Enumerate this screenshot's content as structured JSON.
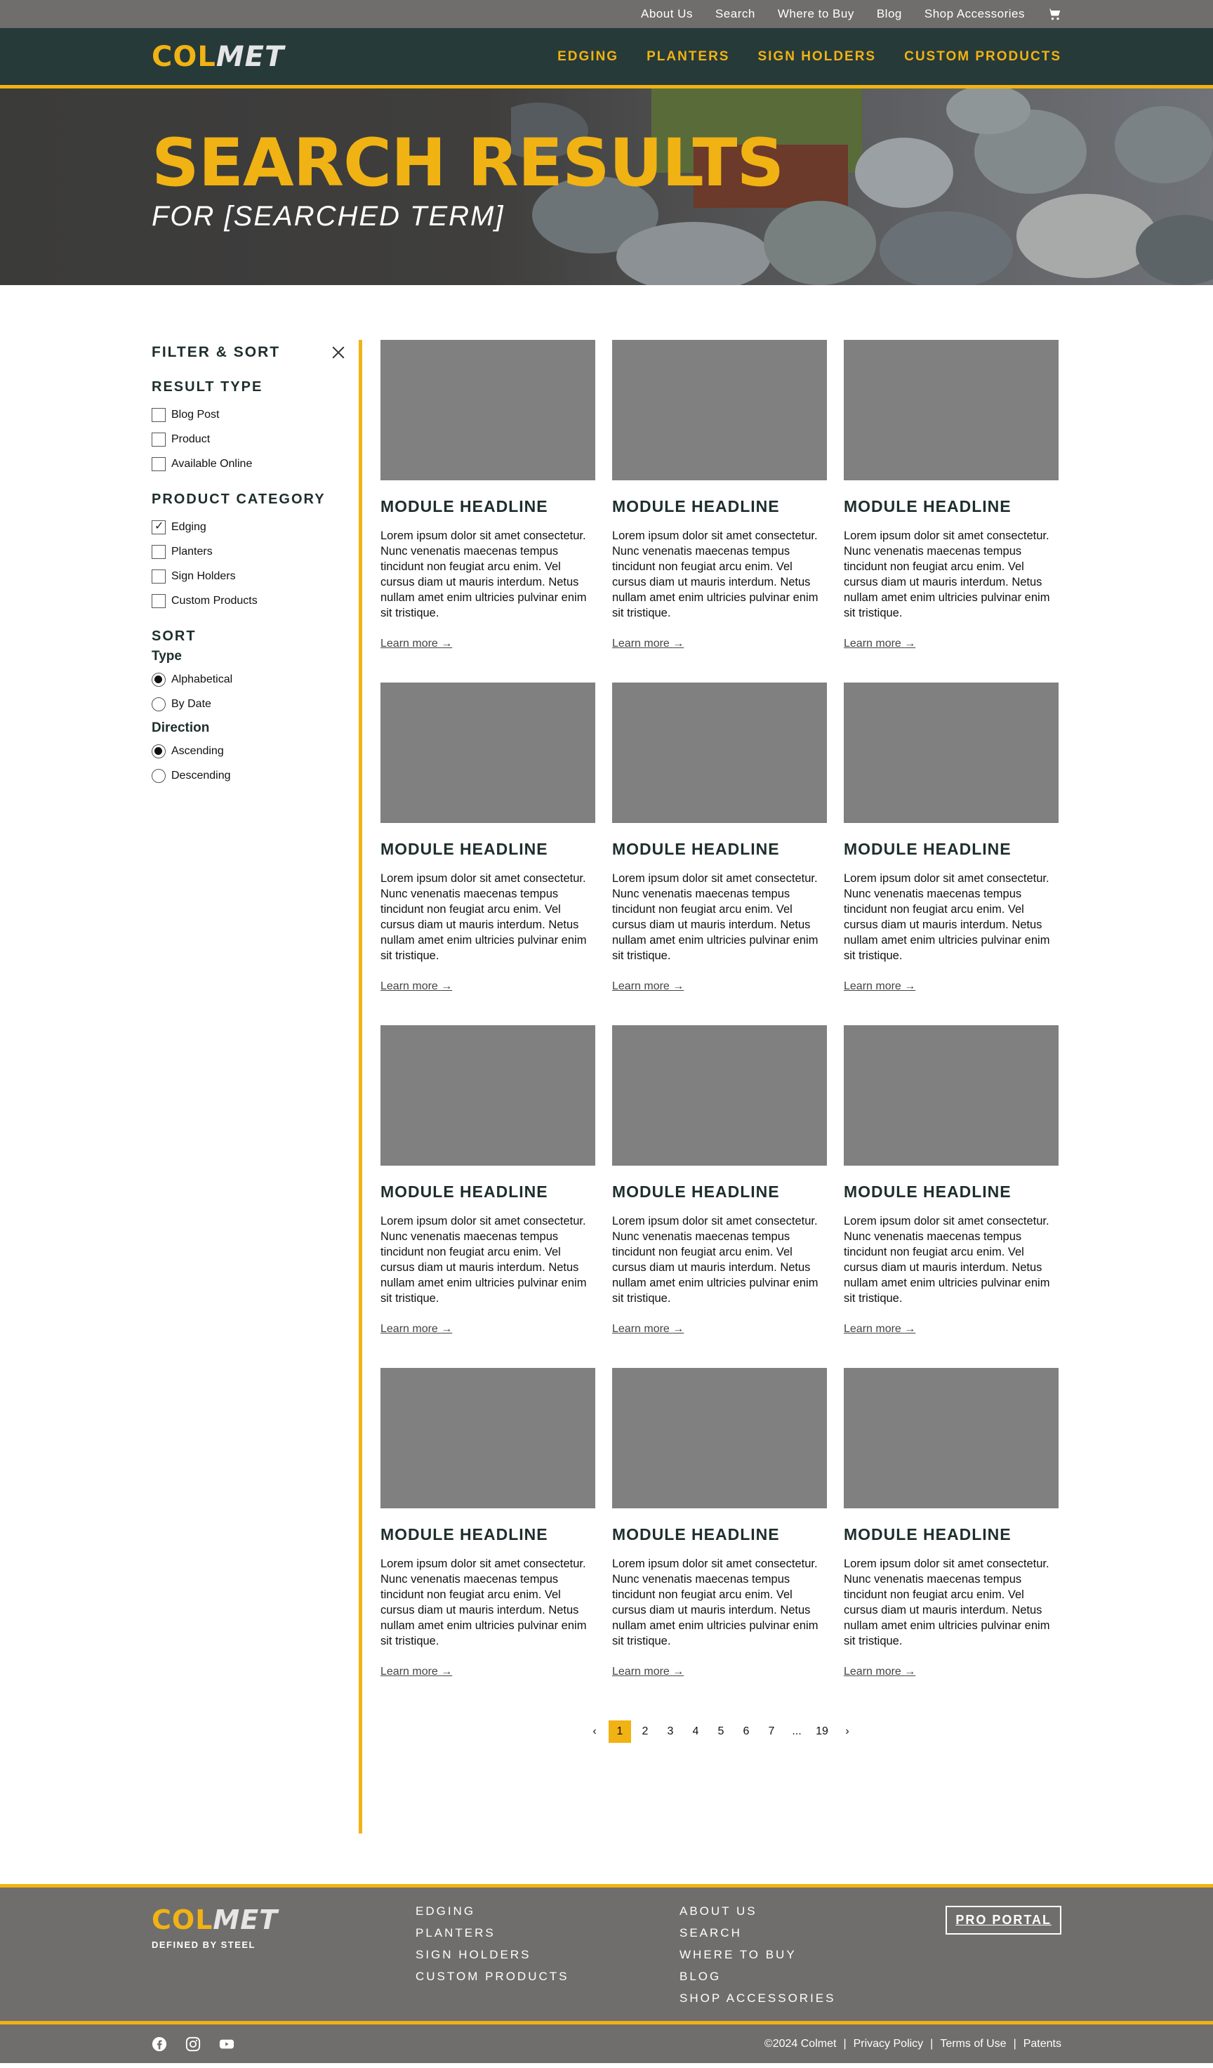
{
  "utility": {
    "links": [
      "About Us",
      "Search",
      "Where to Buy",
      "Blog",
      "Shop Accessories"
    ],
    "cart_icon": "cart-icon"
  },
  "brand": {
    "col": "COL",
    "met": "MET",
    "tagline": "DEFINED BY STEEL"
  },
  "nav": {
    "links": [
      "EDGING",
      "PLANTERS",
      "SIGN HOLDERS",
      "CUSTOM PRODUCTS"
    ]
  },
  "hero": {
    "title": "SEARCH RESULTS",
    "subtitle": "FOR [SEARCHED TERM]"
  },
  "sidebar": {
    "title": "FILTER & SORT",
    "result_type": {
      "title": "RESULT TYPE",
      "options": [
        {
          "label": "Blog Post",
          "checked": false
        },
        {
          "label": "Product",
          "checked": false
        },
        {
          "label": "Available Online",
          "checked": false
        }
      ]
    },
    "product_category": {
      "title": "PRODUCT CATEGORY",
      "options": [
        {
          "label": "Edging",
          "checked": true
        },
        {
          "label": "Planters",
          "checked": false
        },
        {
          "label": "Sign Holders",
          "checked": false
        },
        {
          "label": "Custom Products",
          "checked": false
        }
      ]
    },
    "sort": {
      "title": "SORT",
      "type_title": "Type",
      "type_options": [
        {
          "label": "Alphabetical",
          "selected": true
        },
        {
          "label": "By Date",
          "selected": false
        }
      ],
      "direction_title": "Direction",
      "direction_options": [
        {
          "label": "Ascending",
          "selected": true
        },
        {
          "label": "Descending",
          "selected": false
        }
      ]
    }
  },
  "results": {
    "cards": [
      {
        "headline": "MODULE HEADLINE",
        "body": "Lorem ipsum dolor sit amet consectetur. Nunc venenatis maecenas tempus tincidunt non feugiat arcu enim. Vel cursus diam ut mauris interdum. Netus nullam amet enim ultricies pulvinar enim sit tristique.",
        "link": "Learn more"
      },
      {
        "headline": "MODULE HEADLINE",
        "body": "Lorem ipsum dolor sit amet consectetur. Nunc venenatis maecenas tempus tincidunt non feugiat arcu enim. Vel cursus diam ut mauris interdum. Netus nullam amet enim ultricies pulvinar enim sit tristique.",
        "link": "Learn more"
      },
      {
        "headline": "MODULE HEADLINE",
        "body": "Lorem ipsum dolor sit amet consectetur. Nunc venenatis maecenas tempus tincidunt non feugiat arcu enim. Vel cursus diam ut mauris interdum. Netus nullam amet enim ultricies pulvinar enim sit tristique.",
        "link": "Learn more"
      },
      {
        "headline": "MODULE HEADLINE",
        "body": "Lorem ipsum dolor sit amet consectetur. Nunc venenatis maecenas tempus tincidunt non feugiat arcu enim. Vel cursus diam ut mauris interdum. Netus nullam amet enim ultricies pulvinar enim sit tristique.",
        "link": "Learn more"
      },
      {
        "headline": "MODULE HEADLINE",
        "body": "Lorem ipsum dolor sit amet consectetur. Nunc venenatis maecenas tempus tincidunt non feugiat arcu enim. Vel cursus diam ut mauris interdum. Netus nullam amet enim ultricies pulvinar enim sit tristique.",
        "link": "Learn more"
      },
      {
        "headline": "MODULE HEADLINE",
        "body": "Lorem ipsum dolor sit amet consectetur. Nunc venenatis maecenas tempus tincidunt non feugiat arcu enim. Vel cursus diam ut mauris interdum. Netus nullam amet enim ultricies pulvinar enim sit tristique.",
        "link": "Learn more"
      },
      {
        "headline": "MODULE HEADLINE",
        "body": "Lorem ipsum dolor sit amet consectetur. Nunc venenatis maecenas tempus tincidunt non feugiat arcu enim. Vel cursus diam ut mauris interdum. Netus nullam amet enim ultricies pulvinar enim sit tristique.",
        "link": "Learn more"
      },
      {
        "headline": "MODULE HEADLINE",
        "body": "Lorem ipsum dolor sit amet consectetur. Nunc venenatis maecenas tempus tincidunt non feugiat arcu enim. Vel cursus diam ut mauris interdum. Netus nullam amet enim ultricies pulvinar enim sit tristique.",
        "link": "Learn more"
      },
      {
        "headline": "MODULE HEADLINE",
        "body": "Lorem ipsum dolor sit amet consectetur. Nunc venenatis maecenas tempus tincidunt non feugiat arcu enim. Vel cursus diam ut mauris interdum. Netus nullam amet enim ultricies pulvinar enim sit tristique.",
        "link": "Learn more"
      },
      {
        "headline": "MODULE HEADLINE",
        "body": "Lorem ipsum dolor sit amet consectetur. Nunc venenatis maecenas tempus tincidunt non feugiat arcu enim. Vel cursus diam ut mauris interdum. Netus nullam amet enim ultricies pulvinar enim sit tristique.",
        "link": "Learn more"
      },
      {
        "headline": "MODULE HEADLINE",
        "body": "Lorem ipsum dolor sit amet consectetur. Nunc venenatis maecenas tempus tincidunt non feugiat arcu enim. Vel cursus diam ut mauris interdum. Netus nullam amet enim ultricies pulvinar enim sit tristique.",
        "link": "Learn more"
      },
      {
        "headline": "MODULE HEADLINE",
        "body": "Lorem ipsum dolor sit amet consectetur. Nunc venenatis maecenas tempus tincidunt non feugiat arcu enim. Vel cursus diam ut mauris interdum. Netus nullam amet enim ultricies pulvinar enim sit tristique.",
        "link": "Learn more"
      }
    ]
  },
  "pagination": {
    "pages": [
      "1",
      "2",
      "3",
      "4",
      "5",
      "6",
      "7",
      "...",
      "19"
    ],
    "current": "1"
  },
  "footer": {
    "col1": [
      "EDGING",
      "PLANTERS",
      "SIGN HOLDERS",
      "CUSTOM PRODUCTS"
    ],
    "col2": [
      "ABOUT US",
      "SEARCH",
      "WHERE TO BUY",
      "BLOG",
      "SHOP ACCESSORIES"
    ],
    "pro_portal": "PRO PORTAL",
    "copyright": "©2024 Colmet",
    "legal": [
      "Privacy Policy",
      "Terms of Use",
      "Patents"
    ],
    "social": [
      "facebook-icon",
      "instagram-icon",
      "youtube-icon"
    ]
  },
  "colors": {
    "accent": "#f1b213",
    "nav_bg": "#263a39",
    "utility_bg": "#6f6e6d",
    "placeholder": "#808080"
  }
}
